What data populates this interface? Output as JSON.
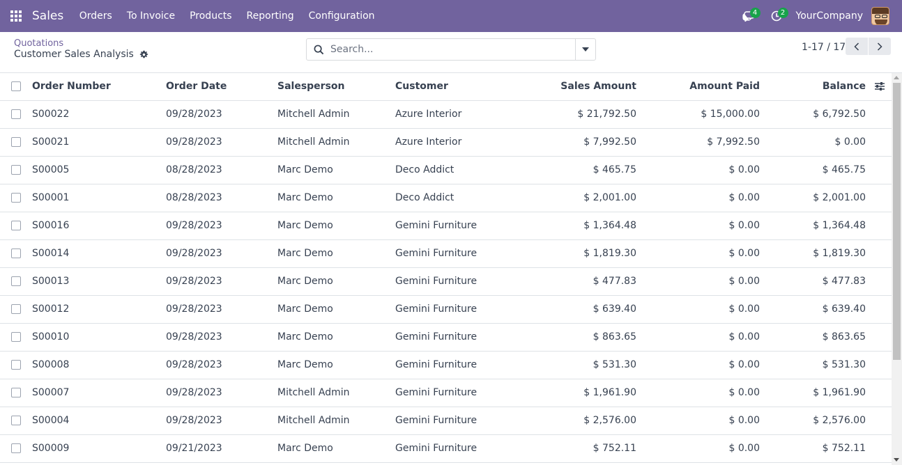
{
  "navbar": {
    "app_name": "Sales",
    "menu": [
      "Orders",
      "To Invoice",
      "Products",
      "Reporting",
      "Configuration"
    ],
    "messages_badge": "4",
    "activities_badge": "2",
    "company": "YourCompany",
    "color": "#71639e"
  },
  "control": {
    "breadcrumb": "Quotations",
    "title": "Customer Sales Analysis",
    "search_placeholder": "Search...",
    "pager": "1-17 / 17"
  },
  "table": {
    "headers": [
      "Order Number",
      "Order Date",
      "Salesperson",
      "Customer",
      "Sales Amount",
      "Amount Paid",
      "Balance"
    ],
    "rows": [
      [
        "S00022",
        "09/28/2023",
        "Mitchell Admin",
        "Azure Interior",
        "$ 21,792.50",
        "$ 15,000.00",
        "$ 6,792.50"
      ],
      [
        "S00021",
        "09/28/2023",
        "Mitchell Admin",
        "Azure Interior",
        "$ 7,992.50",
        "$ 7,992.50",
        "$ 0.00"
      ],
      [
        "S00005",
        "08/28/2023",
        "Marc Demo",
        "Deco Addict",
        "$ 465.75",
        "$ 0.00",
        "$ 465.75"
      ],
      [
        "S00001",
        "08/28/2023",
        "Marc Demo",
        "Deco Addict",
        "$ 2,001.00",
        "$ 0.00",
        "$ 2,001.00"
      ],
      [
        "S00016",
        "09/28/2023",
        "Marc Demo",
        "Gemini Furniture",
        "$ 1,364.48",
        "$ 0.00",
        "$ 1,364.48"
      ],
      [
        "S00014",
        "09/28/2023",
        "Marc Demo",
        "Gemini Furniture",
        "$ 1,819.30",
        "$ 0.00",
        "$ 1,819.30"
      ],
      [
        "S00013",
        "09/28/2023",
        "Marc Demo",
        "Gemini Furniture",
        "$ 477.83",
        "$ 0.00",
        "$ 477.83"
      ],
      [
        "S00012",
        "09/28/2023",
        "Marc Demo",
        "Gemini Furniture",
        "$ 639.40",
        "$ 0.00",
        "$ 639.40"
      ],
      [
        "S00010",
        "09/28/2023",
        "Marc Demo",
        "Gemini Furniture",
        "$ 863.65",
        "$ 0.00",
        "$ 863.65"
      ],
      [
        "S00008",
        "09/28/2023",
        "Marc Demo",
        "Gemini Furniture",
        "$ 531.30",
        "$ 0.00",
        "$ 531.30"
      ],
      [
        "S00007",
        "09/28/2023",
        "Mitchell Admin",
        "Gemini Furniture",
        "$ 1,961.90",
        "$ 0.00",
        "$ 1,961.90"
      ],
      [
        "S00004",
        "09/28/2023",
        "Mitchell Admin",
        "Gemini Furniture",
        "$ 2,576.00",
        "$ 0.00",
        "$ 2,576.00"
      ],
      [
        "S00009",
        "09/21/2023",
        "Marc Demo",
        "Gemini Furniture",
        "$ 752.11",
        "$ 0.00",
        "$ 752.11"
      ]
    ]
  }
}
